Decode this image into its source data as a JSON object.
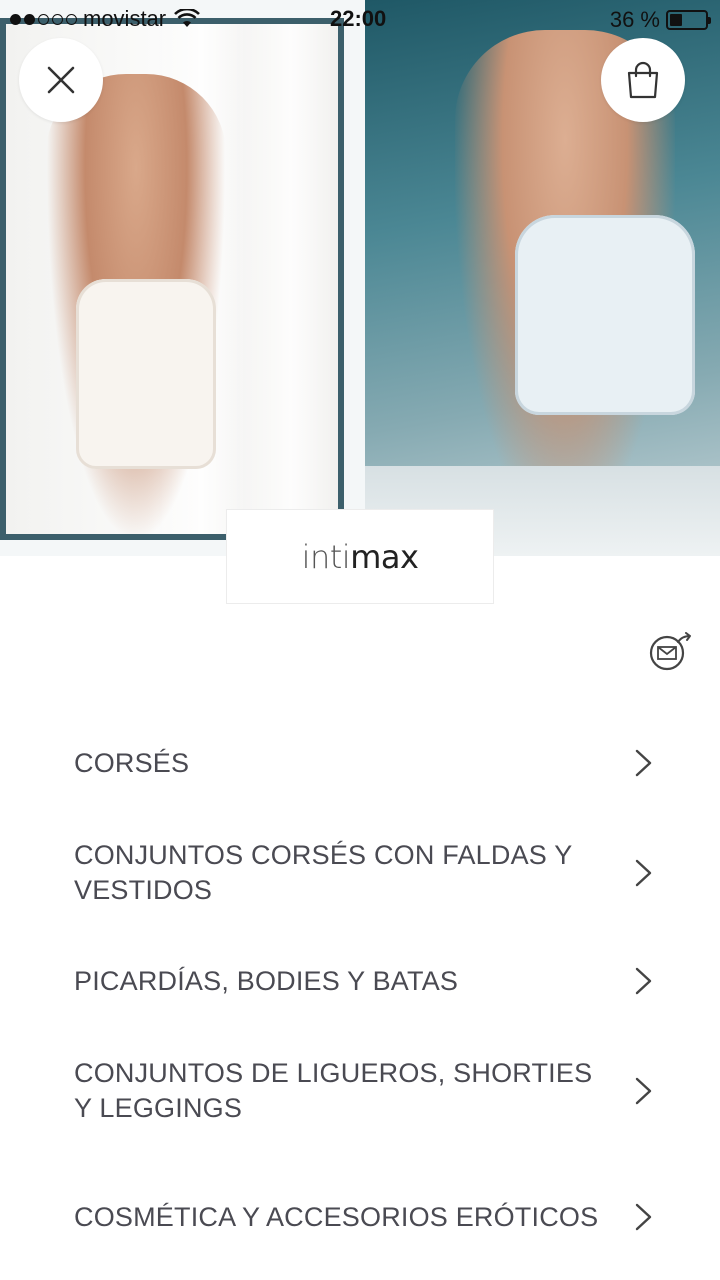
{
  "status_bar": {
    "carrier": "movistar",
    "time": "22:00",
    "battery_text": "36 %",
    "battery_level": 0.36
  },
  "header": {
    "close_icon": "close-icon",
    "bag_icon": "shopping-bag-icon"
  },
  "brand": {
    "logo_light": "inti",
    "logo_bold": "max"
  },
  "newsletter": {
    "icon": "envelope-share-icon"
  },
  "menu": {
    "items": [
      {
        "label": "CORSÉS"
      },
      {
        "label": "CONJUNTOS CORSÉS CON FALDAS Y VESTIDOS"
      },
      {
        "label": "PICARDÍAS, BODIES Y BATAS"
      },
      {
        "label": "CONJUNTOS DE LIGUEROS, SHORTIES Y LEGGINGS"
      },
      {
        "label": "COSMÉTICA Y ACCESORIOS ERÓTICOS"
      }
    ],
    "chevron_icon": "chevron-right-icon"
  },
  "colors": {
    "text": "#4a4a52",
    "frame_left": "#3c5f6b",
    "background": "#ffffff"
  }
}
